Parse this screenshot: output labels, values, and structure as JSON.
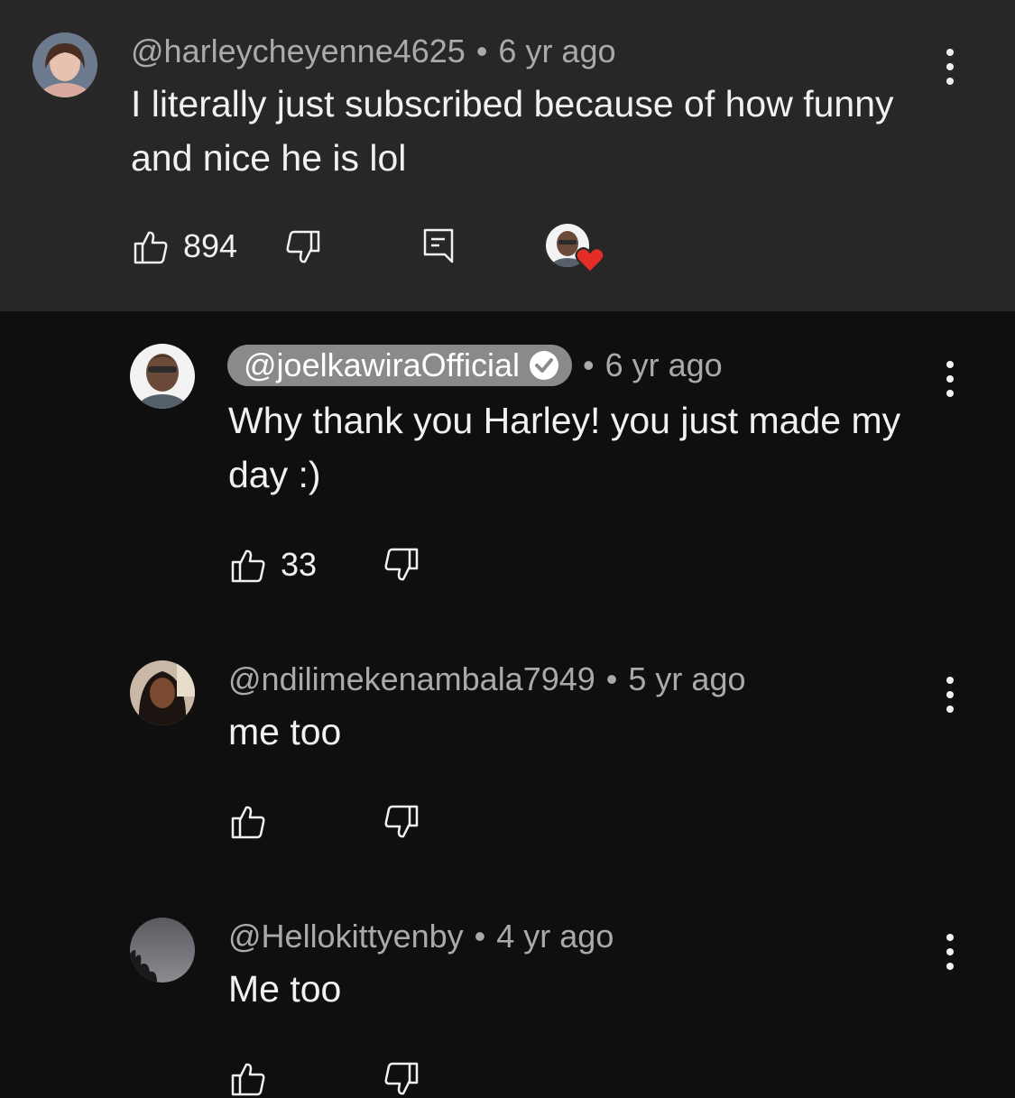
{
  "comments": [
    {
      "handle": "@harleycheyenne4625",
      "separator": "•",
      "time": "6 yr ago",
      "text": "I literally just subscribed because of how funny and nice he is lol",
      "likes": "894",
      "avatar_icon": "user-avatar-woman",
      "reply_icon": "reply-icon",
      "creator_heart": "creator-heart-icon"
    },
    {
      "handle": "@joelkawiraOfficial",
      "verified_icon": "verified-check-icon",
      "separator": "•",
      "time": "6 yr ago",
      "text": "Why thank you Harley! you just made my day :)",
      "likes": "33",
      "avatar_icon": "user-avatar-man"
    },
    {
      "handle": "@ndilimekenambala7949",
      "separator": "•",
      "time": "5 yr ago",
      "text": "me too",
      "likes": "",
      "avatar_icon": "user-avatar-woman"
    },
    {
      "handle": "@Hellokittyenby",
      "separator": "•",
      "time": "4 yr ago",
      "text": "Me too",
      "likes": "",
      "avatar_icon": "user-avatar-sky"
    }
  ],
  "colors": {
    "top_background": "#272727",
    "page_background": "#0f0f0f",
    "text_primary": "#f1f1f1",
    "text_secondary": "#aaaaaa",
    "owner_chip": "#8a8a8a",
    "heart_red": "#e52d27"
  }
}
